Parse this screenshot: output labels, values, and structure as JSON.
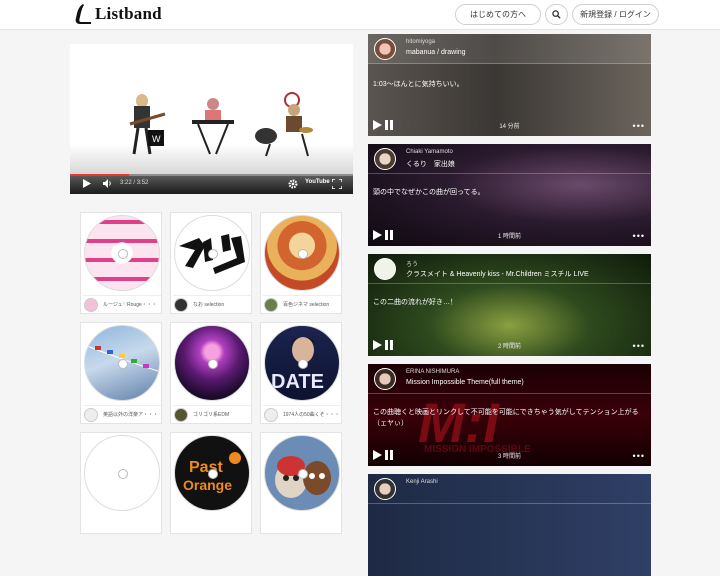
{
  "header": {
    "logo_text": "Listband",
    "first_time_label": "はじめての方へ",
    "search_icon": "search-icon",
    "signup_login_label": "新規登録 / ログイン"
  },
  "video": {
    "current_time": "3:22",
    "duration": "3:52",
    "progress": 0.21,
    "youtube_label": "YouTube"
  },
  "playlists": [
    {
      "caption": "ルージュ♡Rouge・・・"
    },
    {
      "caption": "なお selection"
    },
    {
      "caption": "百色ジネマ selection"
    },
    {
      "caption": "英語以外の洋楽ア・・・"
    },
    {
      "caption": "ゴリゴリ系EDM"
    },
    {
      "caption": "1974人の50曲くそ・・・"
    },
    {
      "caption": ""
    },
    {
      "caption": ""
    },
    {
      "caption": ""
    }
  ],
  "feed": [
    {
      "user": "hitomiyoga",
      "song": "mabanua / drawing",
      "message": "1:03〜ほんとに気持ちいい。",
      "time": "14 分前"
    },
    {
      "user": "Chiaki Yamamoto",
      "song": "くるり　家出娘",
      "message": "頭の中でなぜかこの曲が回ってる。",
      "time": "1 時間前"
    },
    {
      "user": "ろう",
      "song": "クラスメイト & Heavenly kiss - Mr.Children ミスチル LIVE",
      "message": "この二曲の流れが好き…！",
      "time": "2 時間前"
    },
    {
      "user": "ERINA NISHIMURA",
      "song": "Mission Impossible Theme(full theme)",
      "message": "この曲聴くと映画とリンクして不可能を可能にできちゃう気がしてテンション上がる（ェヤぃ）",
      "time": "3 時間前"
    },
    {
      "user": "Kenji Arashi",
      "song": "",
      "message": "",
      "time": ""
    }
  ]
}
